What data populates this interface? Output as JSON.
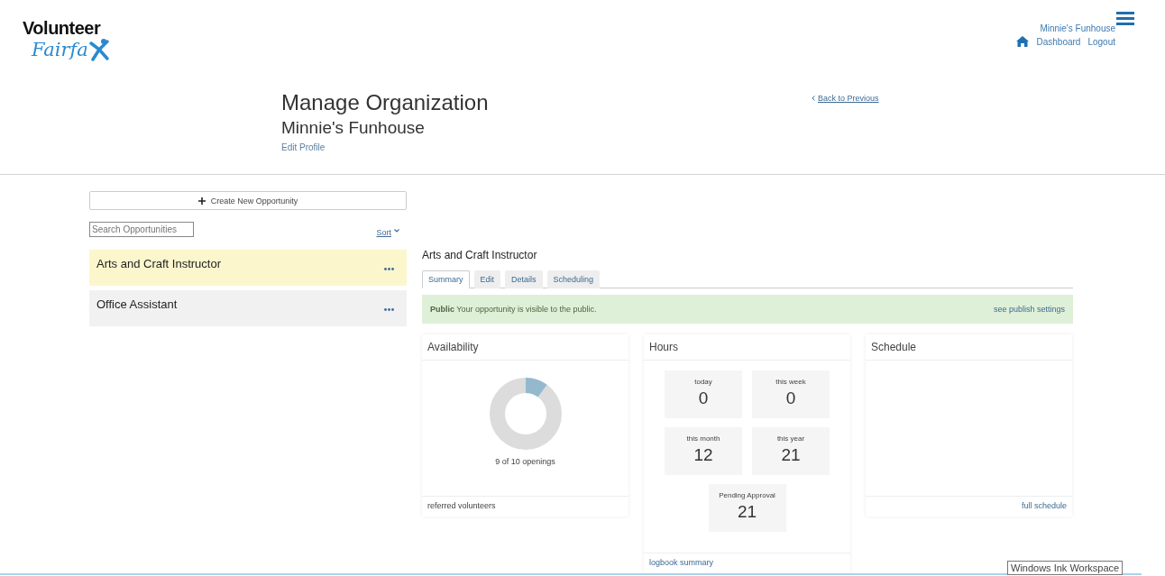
{
  "logo": {
    "top": "Volunteer",
    "bottom": "Fairfa"
  },
  "user_menu": {
    "org": "Minnie's Funhouse",
    "links": [
      "Dashboard",
      "Logout"
    ]
  },
  "header": {
    "title": "Manage Organization",
    "subtitle": "Minnie's Funhouse",
    "edit_link": "Edit Profile",
    "back_link": "Back to Previous"
  },
  "sidebar": {
    "create_button": "Create New Opportunity",
    "search": {
      "placeholder": "Search Opportunities"
    },
    "sort": "Sort",
    "items": [
      {
        "title": "Arts and Craft Instructor",
        "selected": true
      },
      {
        "title": "Office Assistant",
        "selected": false
      }
    ]
  },
  "detail": {
    "title": "Arts and Craft Instructor",
    "tabs": [
      {
        "label": "Summary",
        "selected": true
      },
      {
        "label": "Edit",
        "selected": false
      },
      {
        "label": "Details",
        "selected": false
      },
      {
        "label": "Scheduling",
        "selected": false
      }
    ],
    "alert": {
      "status": "Public",
      "message": "Your opportunity is visible to the public.",
      "link": "see publish settings"
    },
    "availability": {
      "title": "Availability",
      "caption": "9 of 10 openings",
      "footer": "referred volunteers"
    },
    "hours": {
      "title": "Hours",
      "tiles": [
        {
          "label": "today",
          "value": "0"
        },
        {
          "label": "this week",
          "value": "0"
        },
        {
          "label": "this month",
          "value": "12"
        },
        {
          "label": "this year",
          "value": "21"
        },
        {
          "label": "Pending Approval",
          "value": "21"
        }
      ],
      "footer": "logbook summary"
    },
    "schedule": {
      "title": "Schedule",
      "footer": "full schedule"
    }
  },
  "tooltip": "Windows Ink Workspace"
}
